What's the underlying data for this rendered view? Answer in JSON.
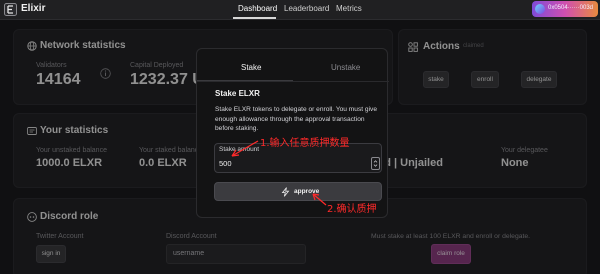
{
  "header": {
    "brand": "Elixir",
    "nav": [
      "Dashboard",
      "Leaderboard",
      "Metrics"
    ],
    "wallet": "0x0504……003d",
    "wallet_visible": "0x0504······003d"
  },
  "network": {
    "title": "Network statistics",
    "validators_label": "Validators",
    "validators_value": "14164",
    "capital_label": "Capital Deployed",
    "capital_value": "1232.37 U"
  },
  "actions": {
    "title": "Actions",
    "claimed": "claimed",
    "buttons": [
      "stake",
      "enroll",
      "delegate"
    ]
  },
  "your_stats": {
    "title": "Your statistics",
    "unstaked_label": "Your unstaked balance",
    "unstaked_value": "1000.0 ELXR",
    "staked_label": "Your staked balance",
    "staked_value": "0.0 ELXR",
    "status_value": "lled | Unjailed",
    "delegatee_label": "Your delegatee",
    "delegatee_value": "None"
  },
  "discord": {
    "title": "Discord role",
    "twitter_label": "Twitter Account",
    "signin": "sign in",
    "discord_label": "Discord Account",
    "username_placeholder": "username",
    "note": "Must stake at least 100 ELXR and enroll or delegate.",
    "claim": "claim role"
  },
  "modal": {
    "tabs": [
      "Stake",
      "Unstake"
    ],
    "heading": "Stake ELXR",
    "description": "Stake ELXR tokens to delegate or enroll. You must give enough allowance through the approval transaction before staking.",
    "amount_label": "Stake amount",
    "amount_value": "500",
    "approve": "approve"
  },
  "annotations": {
    "step1": "1.输入任意质押数量",
    "step2": "2.确认质押",
    "color": "#ff2a2a"
  }
}
